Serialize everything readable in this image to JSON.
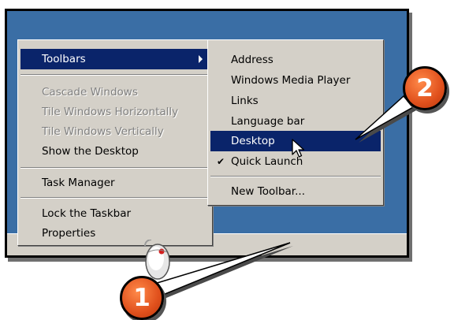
{
  "start_menu": {
    "items": [
      {
        "label": "Toolbars",
        "state": "highlighted",
        "has_submenu": true
      },
      {
        "label": "Cascade Windows",
        "state": "disabled"
      },
      {
        "label": "Tile Windows Horizontally",
        "state": "disabled"
      },
      {
        "label": "Tile Windows Vertically",
        "state": "disabled"
      },
      {
        "label": "Show the Desktop",
        "state": "normal"
      },
      {
        "label": "Task Manager",
        "state": "normal"
      },
      {
        "label": "Lock the Taskbar",
        "state": "normal"
      },
      {
        "label": "Properties",
        "state": "normal"
      }
    ]
  },
  "toolbars_submenu": {
    "items": [
      {
        "label": "Address",
        "state": "normal"
      },
      {
        "label": "Windows Media Player",
        "state": "normal"
      },
      {
        "label": "Links",
        "state": "normal"
      },
      {
        "label": "Language bar",
        "state": "normal"
      },
      {
        "label": "Desktop",
        "state": "highlighted"
      },
      {
        "label": "Quick Launch",
        "state": "normal",
        "checked": true
      },
      {
        "label": "New Toolbar...",
        "state": "normal"
      }
    ]
  },
  "callouts": [
    {
      "number": "1"
    },
    {
      "number": "2"
    }
  ],
  "colors": {
    "desktop": "#3a6ea5",
    "menu_bg": "#d4d0c8",
    "highlight": "#0a246a",
    "badge": "#e0501c"
  },
  "icons": {
    "submenu_arrow": "triangle-right",
    "check": "checkmark",
    "cursor": "arrow-pointer",
    "mouse": "mouse-right-click"
  }
}
